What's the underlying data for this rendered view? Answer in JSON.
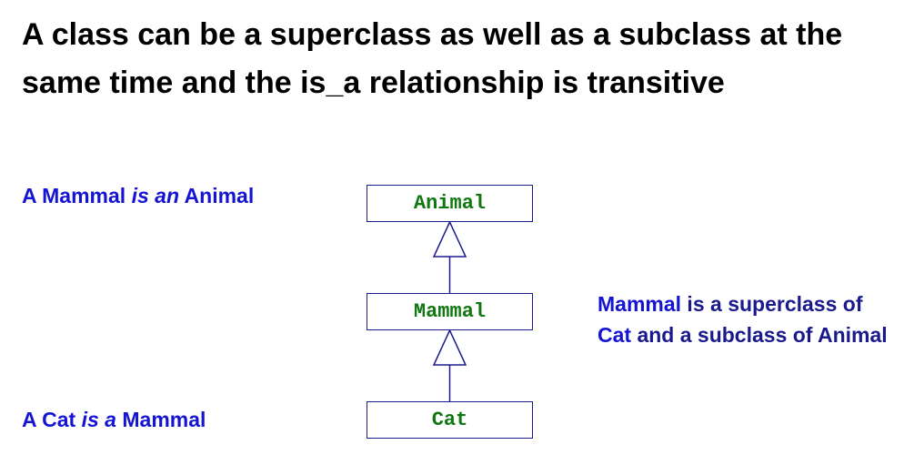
{
  "slide": {
    "title": "A class can be a superclass as well as a subclass at the same time and the is_a relationship is transitive"
  },
  "notes": {
    "mammal_animal": {
      "subject": "A Mammal",
      "verb": "is an",
      "object": "Animal"
    },
    "cat_mammal": {
      "subject": "A Cat",
      "verb": "is a",
      "object": "Mammal"
    },
    "mammal_role": {
      "part1": "Mammal",
      "part2": " is a superclass of ",
      "part3": "Cat",
      "part4": " and a subclass of ",
      "part5": "Animal"
    }
  },
  "diagram": {
    "classes": {
      "animal": "Animal",
      "mammal": "Mammal",
      "cat": "Cat"
    },
    "colors": {
      "line": "#1a1a8c",
      "class_text": "#117711",
      "highlight_text": "#1414d2",
      "note_text": "#1a1a8c"
    }
  }
}
